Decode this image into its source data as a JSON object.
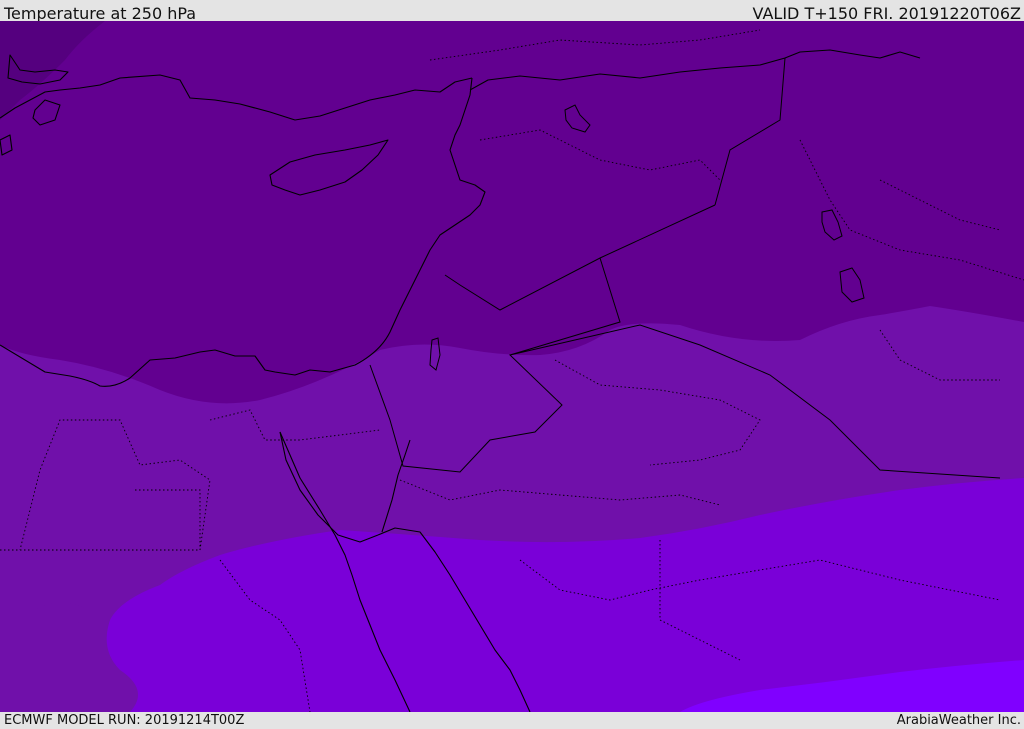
{
  "header": {
    "title": "Temperature at 250 hPa",
    "valid": "VALID T+150 FRI. 20191220T06Z"
  },
  "footer": {
    "model_run": "ECMWF MODEL RUN: 20191214T00Z",
    "credit": "ArabiaWeather Inc."
  },
  "map": {
    "colors": {
      "coldest": "#55007f",
      "band_1": "#620090",
      "band_2": "#7010aa",
      "band_3": "#7a00d8",
      "band_4": "#8000ff",
      "coastline": "#000000"
    }
  }
}
